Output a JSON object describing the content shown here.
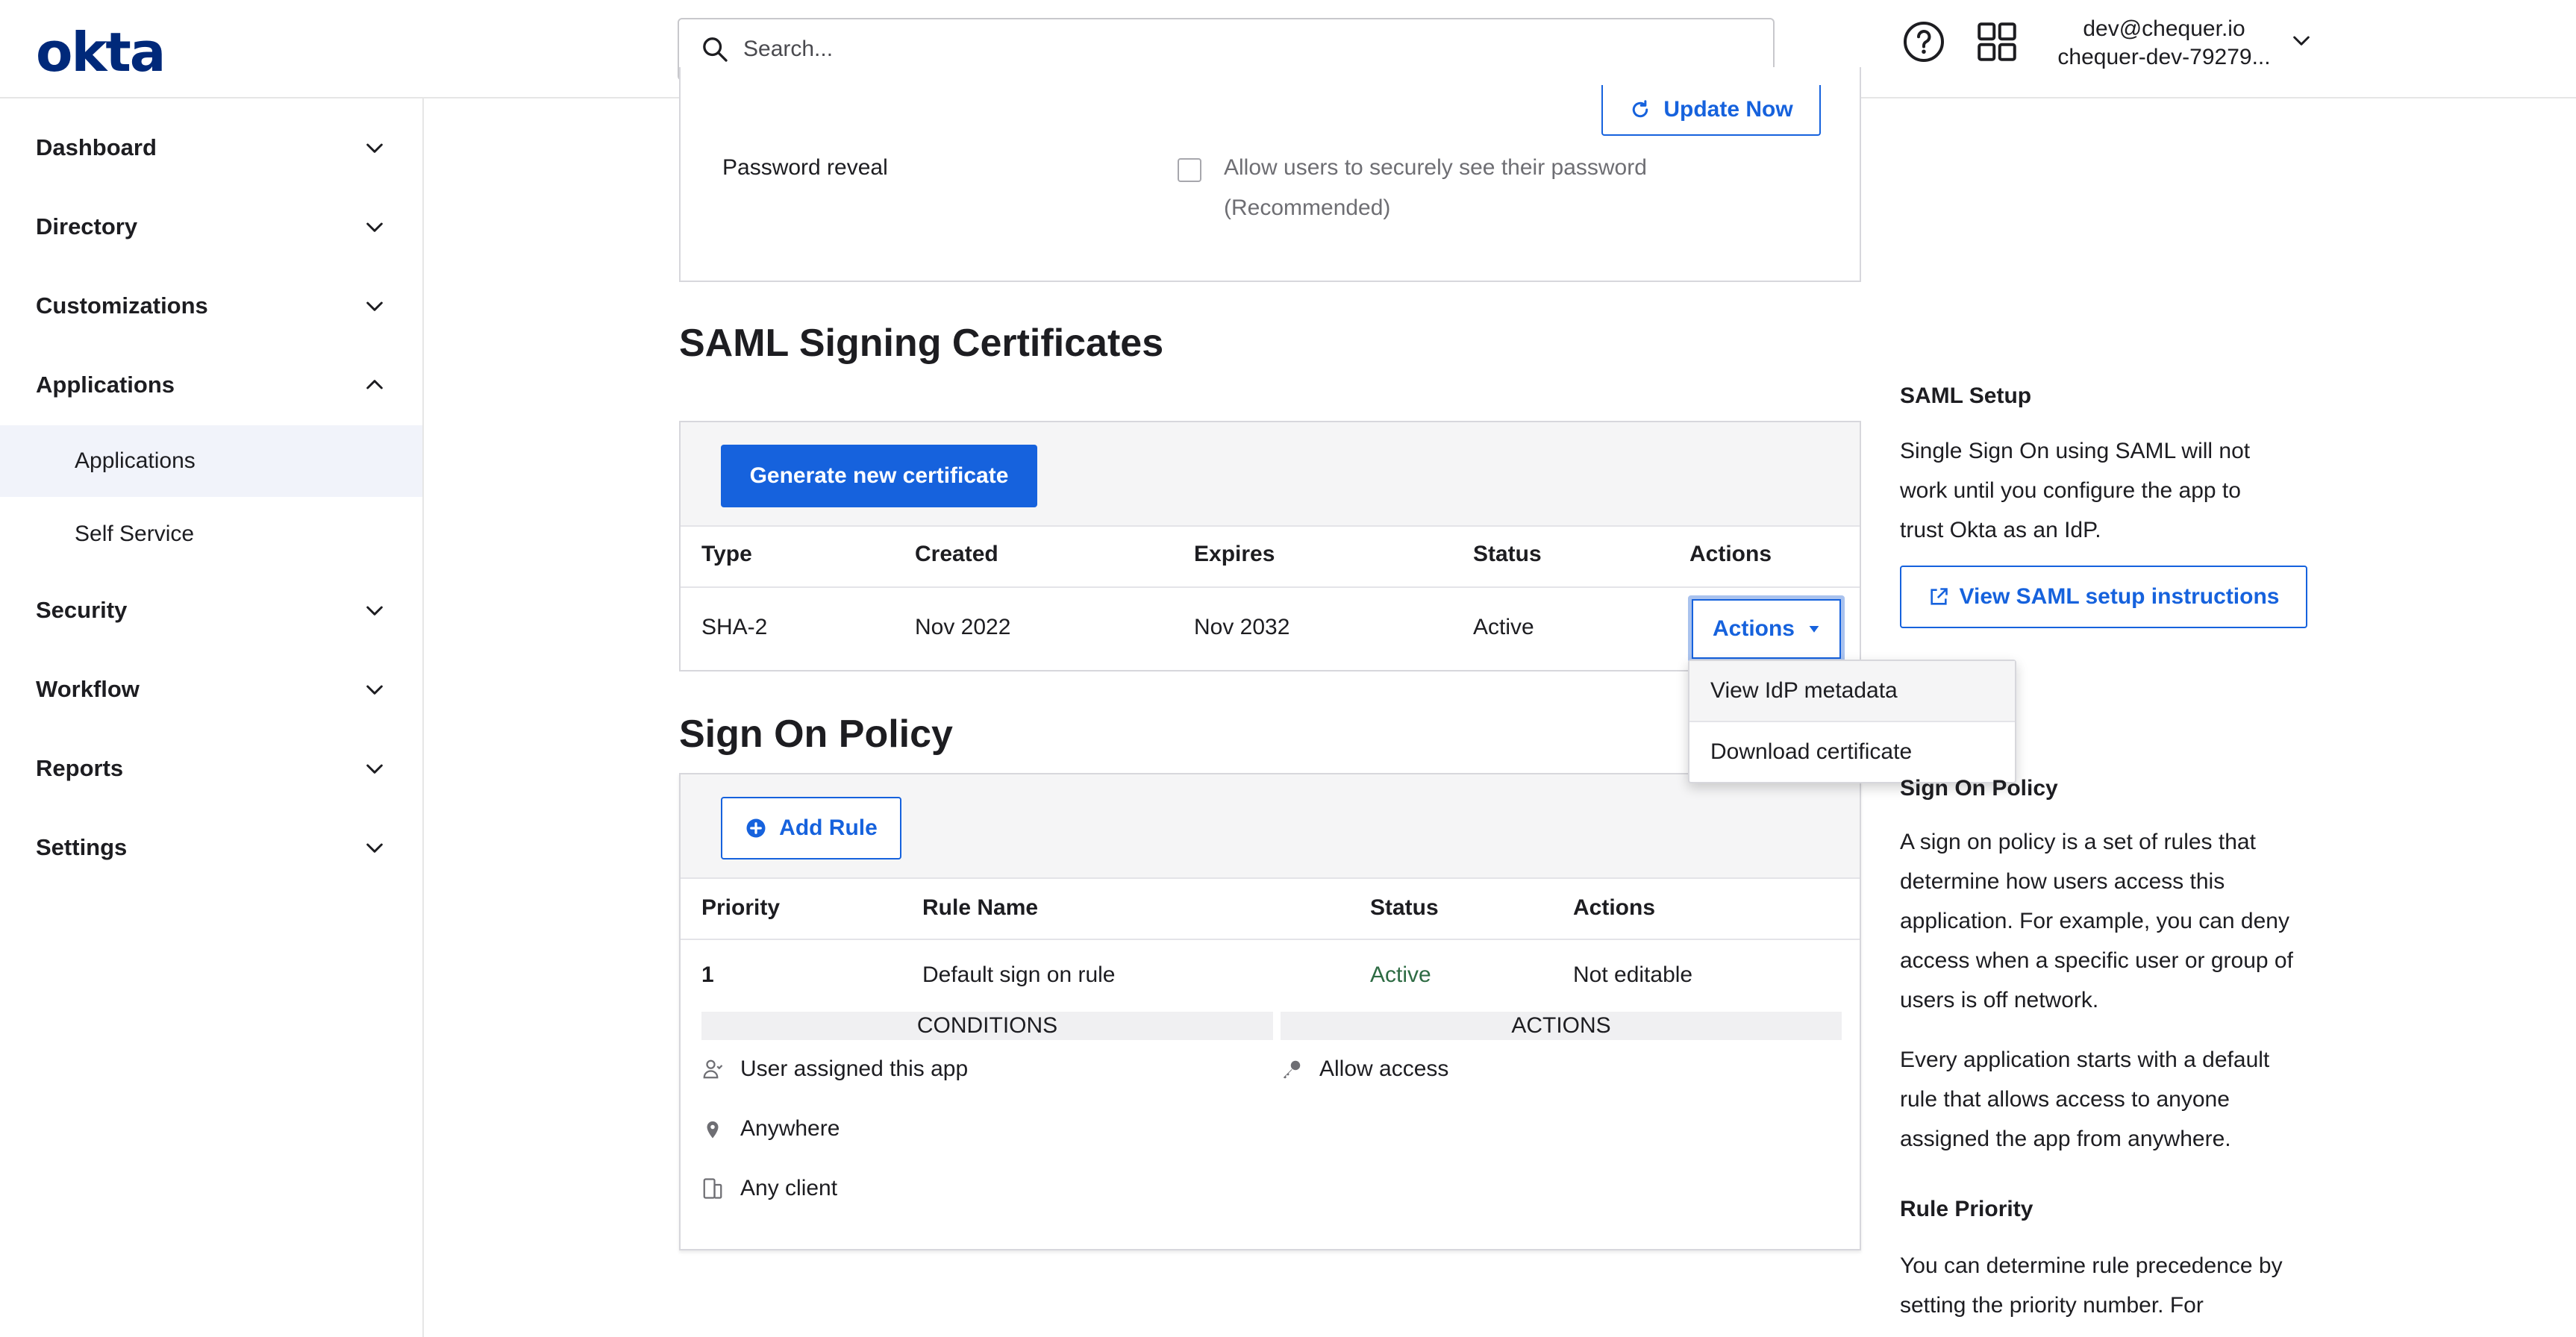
{
  "header": {
    "logo": "okta",
    "search_placeholder": "Search...",
    "user_email": "dev@chequer.io",
    "user_org": "chequer-dev-79279..."
  },
  "sidebar": {
    "items": [
      {
        "label": "Dashboard"
      },
      {
        "label": "Directory"
      },
      {
        "label": "Customizations"
      },
      {
        "label": "Applications",
        "expanded": true
      },
      {
        "label": "Security"
      },
      {
        "label": "Workflow"
      },
      {
        "label": "Reports"
      },
      {
        "label": "Settings"
      }
    ],
    "sub_items": [
      {
        "label": "Applications",
        "active": true
      },
      {
        "label": "Self Service"
      }
    ]
  },
  "main": {
    "update_now_label": "Update Now",
    "password_reveal_label": "Password reveal",
    "password_reveal_option_line1": "Allow users to securely see their password",
    "password_reveal_option_line2": "(Recommended)",
    "saml": {
      "title": "SAML Signing Certificates",
      "generate_button": "Generate new certificate",
      "columns": [
        "Type",
        "Created",
        "Expires",
        "Status",
        "Actions"
      ],
      "rows": [
        {
          "type": "SHA-2",
          "created": "Nov 2022",
          "expires": "Nov 2032",
          "status": "Active",
          "action_label": "Actions"
        }
      ],
      "dropdown": [
        "View IdP metadata",
        "Download certificate"
      ]
    },
    "policy": {
      "title": "Sign On Policy",
      "add_rule_button": "Add Rule",
      "columns": [
        "Priority",
        "Rule Name",
        "Status",
        "Actions"
      ],
      "rows": [
        {
          "priority": "1",
          "rule_name": "Default sign on rule",
          "status": "Active",
          "actions": "Not editable",
          "conditions_header": "CONDITIONS",
          "actions_header": "ACTIONS",
          "conditions": [
            "User assigned this app",
            "Anywhere",
            "Any client"
          ],
          "action_items": [
            "Allow access"
          ]
        }
      ]
    }
  },
  "side_panel": {
    "saml_setup_title": "SAML Setup",
    "saml_setup_text": [
      "Single Sign On using SAML will not",
      "work until you configure the app to",
      "trust Okta as an IdP."
    ],
    "saml_setup_button": "View SAML setup instructions",
    "policy_title": "Sign On Policy",
    "policy_text": [
      "A sign on policy is a set of rules that",
      "determine how users access this",
      "application. For example, you can deny",
      "access when a specific user or group of",
      "users is off network."
    ],
    "policy_text2": [
      "Every application starts with a default",
      "rule that allows access to anyone",
      "assigned the app from anywhere."
    ],
    "priority_title": "Rule Priority",
    "priority_text": [
      "You can determine rule precedence by",
      "setting the priority number. For"
    ]
  },
  "colors": {
    "brand": "#00297a",
    "primary": "#1662dd",
    "active_status": "#2d6b43"
  }
}
